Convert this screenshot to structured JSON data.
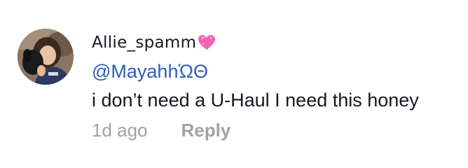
{
  "comment": {
    "username": "Allie_spamm",
    "username_emoji": "sparkling-heart-icon",
    "mention": "@MayahhὩΘ",
    "text": "i don’t need a U-Haul I need this honey",
    "timestamp": "1d ago",
    "reply_label": "Reply"
  },
  "colors": {
    "username": "#161823",
    "mention": "#2b5db9",
    "body": "#161823",
    "meta": "#a1a2a7",
    "heart": "#f263b3"
  }
}
